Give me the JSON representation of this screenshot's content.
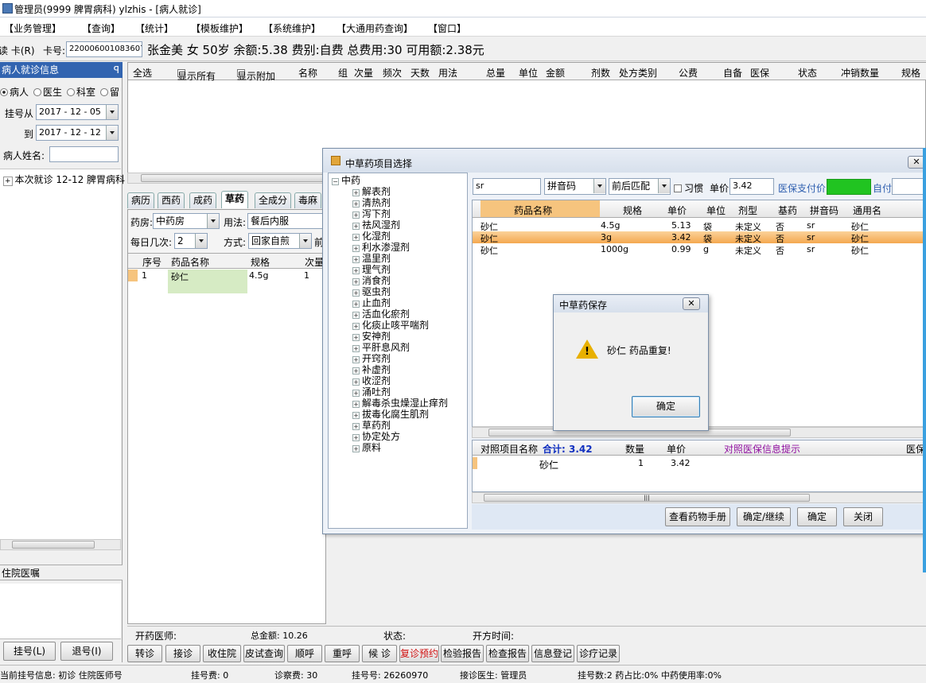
{
  "window": {
    "title": "管理员(9999 脾胃病科) ylzhis - [病人就诊]"
  },
  "menu": [
    "【业务管理】",
    "【查询】",
    "【统计】",
    "【模板维护】",
    "【系统维护】",
    "【大通用药查询】",
    "【窗口】"
  ],
  "patient_bar": {
    "read_card": "读 卡(R)",
    "card_label": "卡号:",
    "card_no": "220006001083607",
    "summary": "张金美 女 50岁 余额:5.38 费别:自费 总费用:30 可用额:2.38元"
  },
  "left_panel": {
    "header": "病人就诊信息",
    "pin": "ꟼ",
    "radios": [
      "病人",
      "医生",
      "科室",
      "留"
    ],
    "reg_from_label": "挂号从",
    "reg_from": "2017 - 12 - 05",
    "reg_to_label": "到",
    "reg_to": "2017 - 12 - 12",
    "name_label": "病人姓名:",
    "visit": "本次就诊 12-12 脾胃病科",
    "inpatient_header": "住院医嘱",
    "register_btn": "挂号(L)",
    "unregister_btn": "退号(I)"
  },
  "main_grid": {
    "headers": [
      "全选",
      "显示所有",
      "显示附加",
      "名称",
      "组",
      "次量",
      "频次",
      "天数",
      "用法",
      "总量",
      "单位",
      "金额",
      "剂数",
      "处方类别",
      "公费",
      "自备",
      "医保",
      "状态",
      "冲销数量",
      "规格"
    ]
  },
  "tabs": [
    "病历",
    "西药",
    "成药",
    "草药",
    "全成分",
    "毒麻"
  ],
  "herb_form": {
    "pharmacy_label": "药房:",
    "pharmacy": "中药房",
    "usage_label": "用法:",
    "usage": "餐后内服",
    "daily_label": "每日几次:",
    "daily": "2",
    "method_label": "方式:",
    "method": "回家自煎",
    "front": "前"
  },
  "herb_grid": {
    "headers": [
      "序号",
      "药品名称",
      "规格",
      "次量"
    ],
    "rows": [
      {
        "no": "1",
        "name": "砂仁",
        "spec": "4.5g",
        "qty": "1"
      }
    ]
  },
  "footer_info": {
    "doctor": "开药医师:",
    "total": "总金额: 10.26",
    "status": "状态:",
    "time": "开方时间:"
  },
  "bottom_buttons": [
    "转诊",
    "接诊",
    "收住院",
    "皮试查询",
    "顺呼",
    "重呼",
    "候 诊",
    "复诊预约",
    "检验报告",
    "检查报告",
    "信息登记",
    "诊疗记录"
  ],
  "status_bar": {
    "current": "当前挂号信息: 初诊 住院医师号",
    "reg_fee": "挂号费: 0",
    "exam_fee": "诊察费: 30",
    "reg_no": "挂号号: 26260970",
    "doctor": "接诊医生: 管理员",
    "stats": "挂号数:2 药占比:0% 中药使用率:0%"
  },
  "herb_dialog": {
    "title": "中草药项目选择",
    "close": "✕",
    "tree_root": "中药",
    "tree_items": [
      "解表剂",
      "清热剂",
      "泻下剂",
      "祛风湿剂",
      "化湿剂",
      "利水渗湿剂",
      "温里剂",
      "理气剂",
      "消食剂",
      "驱虫剂",
      "止血剂",
      "活血化瘀剂",
      "化痰止咳平喘剂",
      "安神剂",
      "平肝息风剂",
      "开窍剂",
      "补虚剂",
      "收涩剂",
      "涌吐剂",
      "解毒杀虫燥湿止痒剂",
      "拔毒化腐生肌剂",
      "草药剂",
      "协定处方",
      "原料"
    ],
    "search": "sr",
    "code_type": "拼音码",
    "match_type": "前后匹配",
    "habit_label": "习惯",
    "price_label": "单价",
    "price": "3.42",
    "insurance_label": "医保支付价",
    "self_label": "自付",
    "headers": [
      "药品名称",
      "规格",
      "单价",
      "单位",
      "剂型",
      "基药",
      "拼音码",
      "通用名"
    ],
    "rows": [
      {
        "name": "砂仁",
        "spec": "4.5g",
        "price": "5.13",
        "unit": "袋",
        "form": "未定义",
        "base": "否",
        "code": "sr",
        "generic": "砂仁"
      },
      {
        "name": "砂仁",
        "spec": "3g",
        "price": "3.42",
        "unit": "袋",
        "form": "未定义",
        "base": "否",
        "code": "sr",
        "generic": "砂仁"
      },
      {
        "name": "砂仁",
        "spec": "1000g",
        "price": "0.99",
        "unit": "g",
        "form": "未定义",
        "base": "否",
        "code": "sr",
        "generic": "砂仁"
      }
    ],
    "lower_headers": {
      "name": "对照项目名称",
      "total": "合计: 3.42",
      "qty": "数量",
      "price": "单价",
      "hint": "对照医保信息提示",
      "ins": "医保"
    },
    "lower_row": {
      "name": "砂仁",
      "qty": "1",
      "price": "3.42"
    },
    "buttons": [
      "查看药物手册",
      "确定/继续",
      "确定",
      "关闭"
    ],
    "scroll_mark": "|||"
  },
  "message_box": {
    "title": "中草药保存",
    "close": "✕",
    "text": "砂仁 药品重复!",
    "ok": "确定",
    "icon_mark": "!"
  },
  "colors": {
    "accent_blue": "#3264b0",
    "selected_row": "#f8b35a",
    "insurance_green": "#21c421",
    "header_orange": "#f6c47e"
  }
}
